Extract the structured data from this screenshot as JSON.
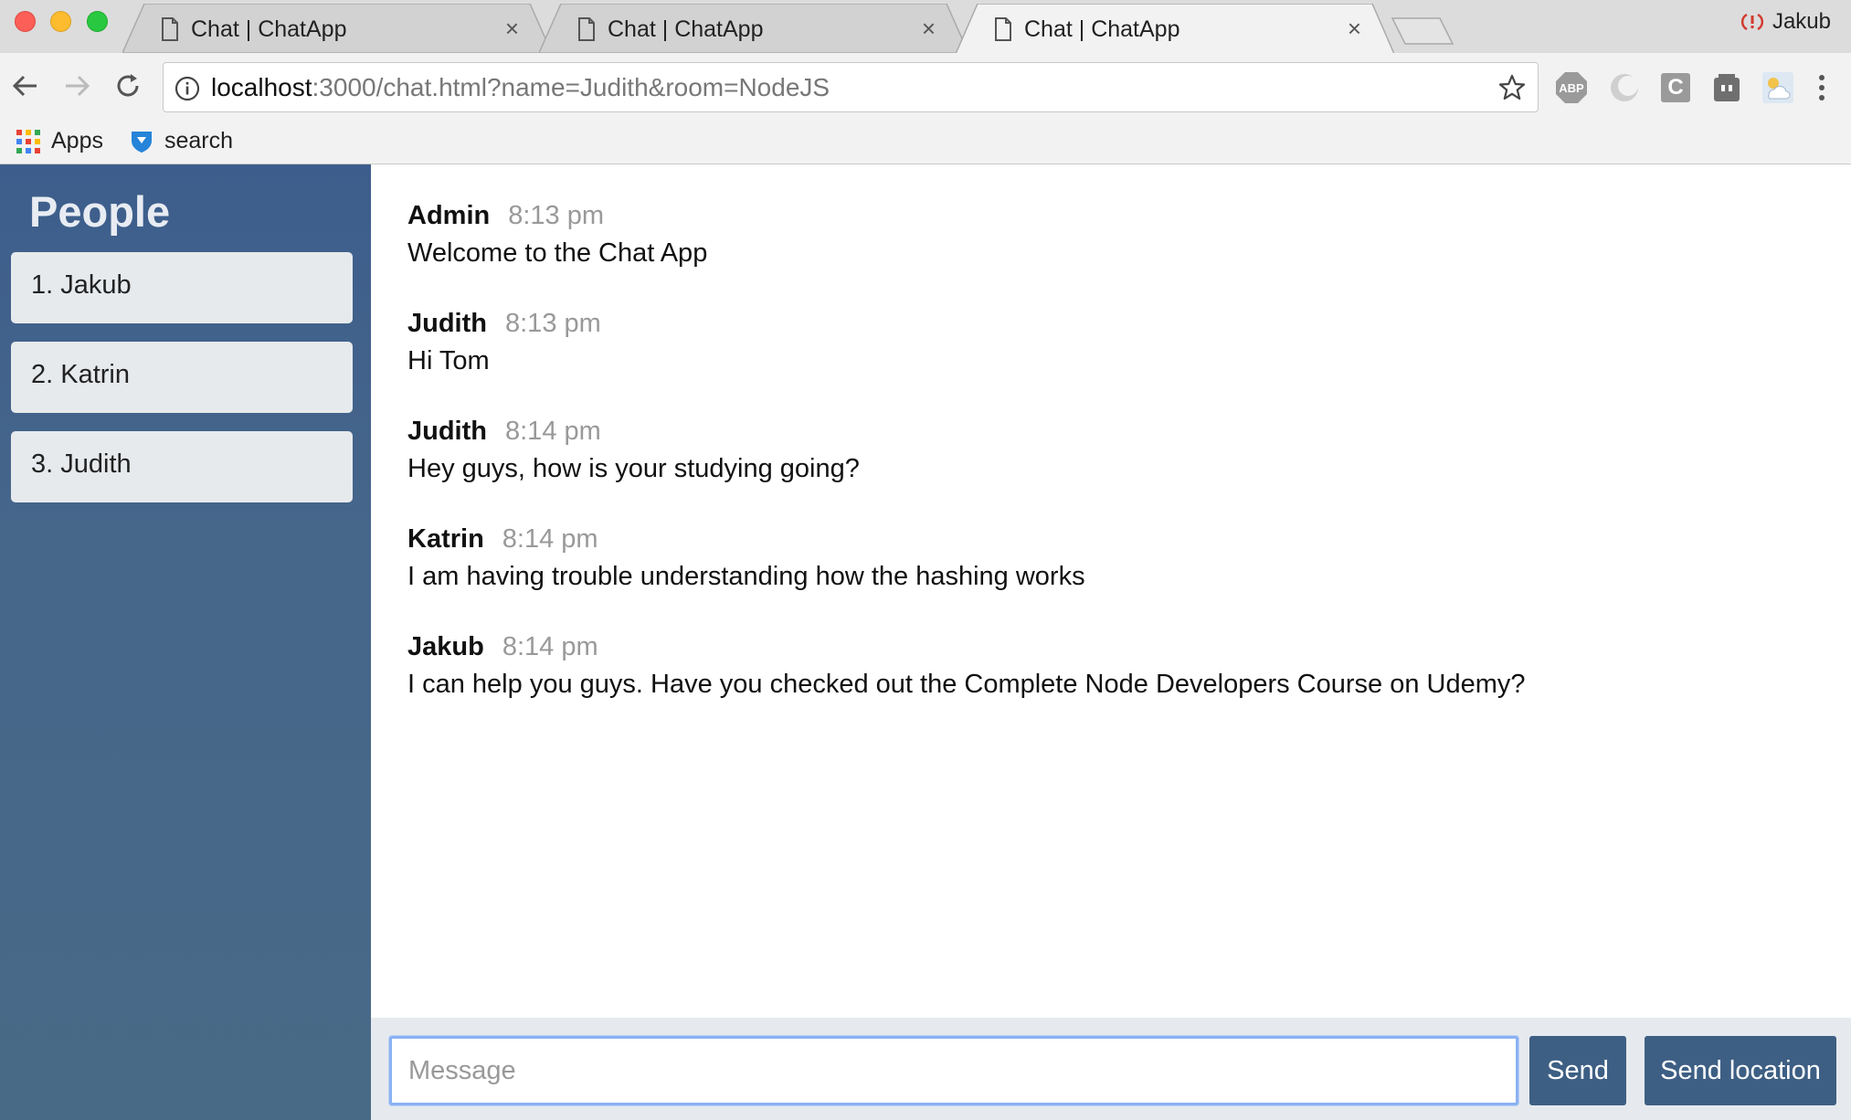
{
  "window": {
    "tabs": [
      {
        "title": "Chat | ChatApp",
        "close": "×"
      },
      {
        "title": "Chat | ChatApp",
        "close": "×"
      },
      {
        "title": "Chat | ChatApp",
        "close": "×"
      }
    ],
    "profile_name": "Jakub",
    "profile_icon": "sync-error-icon"
  },
  "toolbar": {
    "url_host": "localhost",
    "url_rest": ":3000/chat.html?name=Judith&room=NodeJS",
    "extensions": [
      "adblock-plus-icon",
      "extension-icon",
      "clipboard-c-icon",
      "extension-face-icon",
      "extension-weather-icon"
    ],
    "abp_label": "ABP",
    "c_label": "C"
  },
  "bookmarks": [
    {
      "label": "Apps",
      "icon": "apps-grid-icon"
    },
    {
      "label": "search",
      "icon": "shield-icon"
    }
  ],
  "sidebar": {
    "title": "People",
    "people": [
      "1. Jakub",
      "2. Katrin",
      "3. Judith"
    ]
  },
  "messages": [
    {
      "author": "Admin",
      "time": "8:13 pm",
      "text": "Welcome to the Chat App"
    },
    {
      "author": "Judith",
      "time": "8:13 pm",
      "text": "Hi Tom"
    },
    {
      "author": "Judith",
      "time": "8:14 pm",
      "text": "Hey guys, how is your studying going?"
    },
    {
      "author": "Katrin",
      "time": "8:14 pm",
      "text": "I am having trouble understanding how the hashing works"
    },
    {
      "author": "Jakub",
      "time": "8:14 pm",
      "text": "I can help you guys. Have you checked out the Complete Node Developers Course on Udemy?"
    }
  ],
  "composer": {
    "placeholder": "Message",
    "value": "",
    "send_label": "Send",
    "location_label": "Send location"
  },
  "colors": {
    "sidebar_top": "#3d5e8c",
    "sidebar_bottom": "#486a86",
    "button": "#3e5f84",
    "footer": "#e6eaee",
    "input_focus": "#8ab1f1"
  }
}
